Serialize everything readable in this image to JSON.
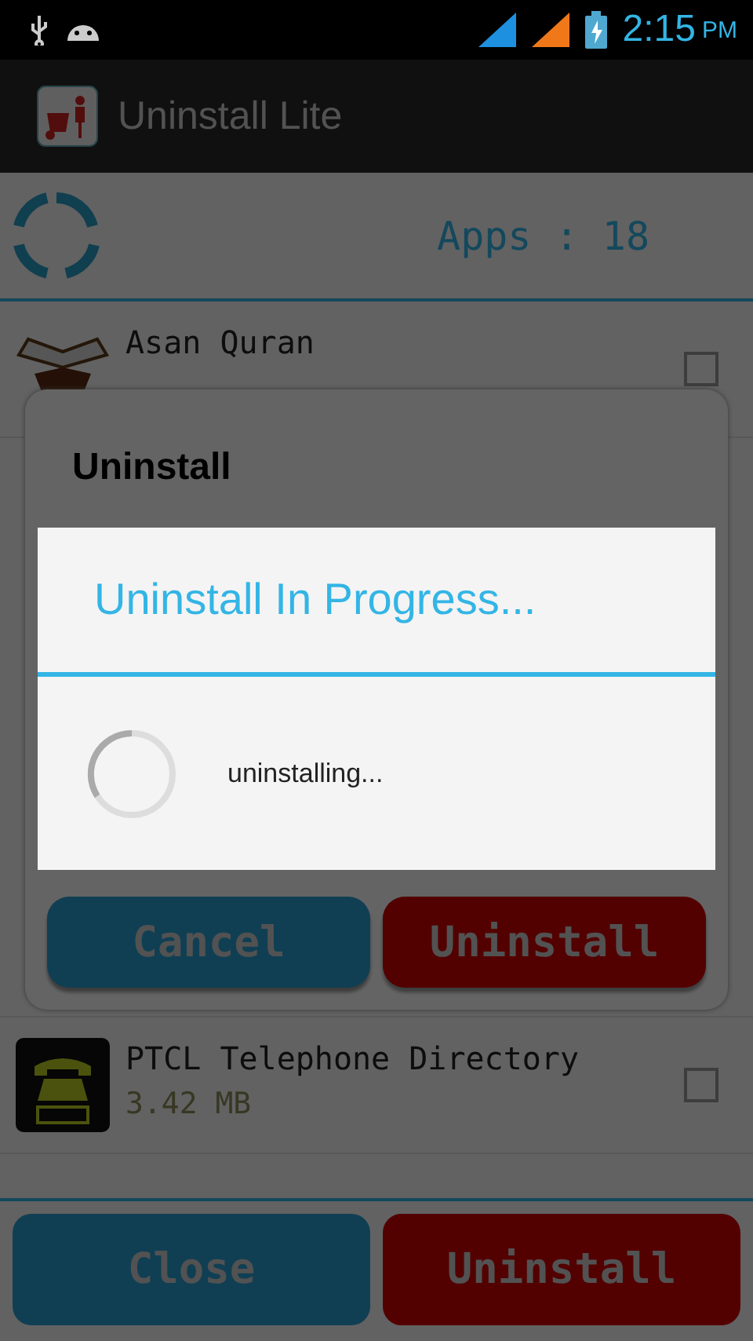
{
  "status_bar": {
    "time": "2:15",
    "ampm": "PM"
  },
  "app_bar": {
    "title": "Uninstall Lite"
  },
  "header": {
    "count": "Apps : 18"
  },
  "apps": [
    {
      "name": "Asan Quran",
      "checked": false,
      "kind": "book"
    },
    {
      "name": "PTCL Telephone Directory",
      "size": "3.42 MB",
      "checked": false,
      "kind": "phone"
    }
  ],
  "bottom_buttons": [
    {
      "label": "Close",
      "kind": "secondary"
    },
    {
      "label": "Uninstall",
      "kind": "danger"
    }
  ],
  "dialog": {
    "title": "Uninstall",
    "buttons": [
      {
        "label": "Cancel",
        "kind": "secondary"
      },
      {
        "label": "Uninstall",
        "kind": "danger"
      }
    ]
  },
  "progress": {
    "title": "Uninstall In Progress...",
    "message": "uninstalling..."
  }
}
